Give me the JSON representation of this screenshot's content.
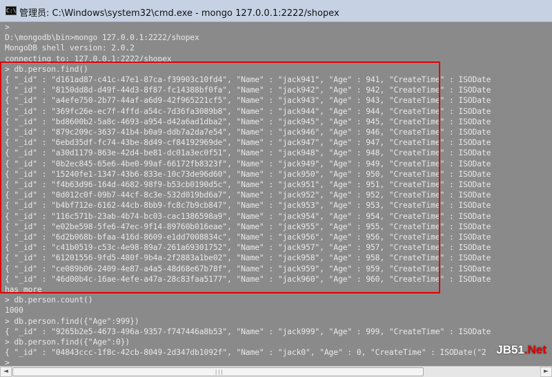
{
  "window": {
    "title": "管理员: C:\\Windows\\system32\\cmd.exe - mongo  127.0.0.1:2222/shopex",
    "icon": "cmd-icon"
  },
  "console": {
    "lines": [
      ">",
      "D:\\mongodb\\bin>mongo 127.0.0.1:2222/shopex",
      "MongoDB shell version: 2.0.2",
      "connecting to: 127.0.0.1:2222/shopex",
      "> db.person.find()",
      "{ \"_id\" : \"d161ad87-c41c-47e1-87ca-f39903c10fd4\", \"Name\" : \"jack941\", \"Age\" : 941, \"CreateTime\" : ISODate",
      "{ \"_id\" : \"8150dd8d-d49f-44d3-8f87-fc14388bf0fa\", \"Name\" : \"jack942\", \"Age\" : 942, \"CreateTime\" : ISODate",
      "{ \"_id\" : \"a4efe750-2b77-44af-a6d9-42f965221cf5\", \"Name\" : \"jack943\", \"Age\" : 943, \"CreateTime\" : ISODate",
      "{ \"_id\" : \"369fc26e-ec7f-4ffd-a54c-7d36fa3089b8\", \"Name\" : \"jack944\", \"Age\" : 944, \"CreateTime\" : ISODate",
      "{ \"_id\" : \"bd8600b2-5a8c-4693-a954-d42a6ad1dba2\", \"Name\" : \"jack945\", \"Age\" : 945, \"CreateTime\" : ISODate",
      "{ \"_id\" : \"879c209c-3637-41b4-b0a9-ddb7a2da7e54\", \"Name\" : \"jack946\", \"Age\" : 946, \"CreateTime\" : ISODate",
      "{ \"_id\" : \"6ebd35df-fc74-43be-8d49-cf84192969de\", \"Name\" : \"jack947\", \"Age\" : 947, \"CreateTime\" : ISODate",
      "{ \"_id\" : \"a30d1179-863e-42d4-be81-dc01a3ec0f51\", \"Name\" : \"jack948\", \"Age\" : 948, \"CreateTime\" : ISODate",
      "{ \"_id\" : \"0b2ec845-65e6-4be0-99af-66172fb8323f\", \"Name\" : \"jack949\", \"Age\" : 949, \"CreateTime\" : ISODate",
      "{ \"_id\" : \"15240fe1-1347-43b6-833e-10c73de96d60\", \"Name\" : \"jack950\", \"Age\" : 950, \"CreateTime\" : ISODate",
      "{ \"_id\" : \"f4b63d96-164d-4682-98f9-b53cb0190d5c\", \"Name\" : \"jack951\", \"Age\" : 951, \"CreateTime\" : ISODate",
      "{ \"_id\" : \"0d012c0f-09b7-44cf-8c3e-532d019bd6a7\", \"Name\" : \"jack952\", \"Age\" : 952, \"CreateTime\" : ISODate",
      "{ \"_id\" : \"b4bf712e-6162-44cb-8bb9-fc8c7b9cb847\", \"Name\" : \"jack953\", \"Age\" : 953, \"CreateTime\" : ISODate",
      "{ \"_id\" : \"116c571b-23ab-4b74-bc03-cac1386598a9\", \"Name\" : \"jack954\", \"Age\" : 954, \"CreateTime\" : ISODate",
      "{ \"_id\" : \"e02be598-5fe6-47ec-9f14-89760b016eae\", \"Name\" : \"jack955\", \"Age\" : 955, \"CreateTime\" : ISODate",
      "{ \"_id\" : \"6d2b068b-bfaa-416d-8609-e1dd7008834c\", \"Name\" : \"jack956\", \"Age\" : 956, \"CreateTime\" : ISODate",
      "{ \"_id\" : \"c41b0519-c53c-4e98-89a7-261a69301752\", \"Name\" : \"jack957\", \"Age\" : 957, \"CreateTime\" : ISODate",
      "{ \"_id\" : \"61201556-9fd5-480f-9b4a-2f2883a1be02\", \"Name\" : \"jack958\", \"Age\" : 958, \"CreateTime\" : ISODate",
      "{ \"_id\" : \"ce089b06-2409-4e87-a4a5-48d68e67b78f\", \"Name\" : \"jack959\", \"Age\" : 959, \"CreateTime\" : ISODate",
      "{ \"_id\" : \"46d00b4c-16ae-4efe-a47a-28c83faa5177\", \"Name\" : \"jack960\", \"Age\" : 960, \"CreateTime\" : ISODate",
      "has more",
      "> db.person.count()",
      "1000",
      "> db.person.find({\"Age\":999})",
      "{ \"_id\" : \"9265b2e5-4673-496a-9357-f747446a8b53\", \"Name\" : \"jack999\", \"Age\" : 999, \"CreateTime\" : ISODate",
      "> db.person.find({\"Age\":0})",
      "{ \"_id\" : \"04843ccc-1f8c-42cb-8049-2d347db1092f\", \"Name\" : \"jack0\", \"Age\" : 0, \"CreateTime\" : ISODate(\"2",
      ">"
    ]
  },
  "scrollbar": {
    "left_arrow": "◄",
    "right_arrow": "►",
    "grip": "|||"
  },
  "watermark": {
    "text": "JB51",
    "suffix": ".Net"
  },
  "colors": {
    "console_bg": "#8a8a8a",
    "console_fg": "#e8e8e8",
    "highlight": "#e00000",
    "titlebar": "#c6d2e4"
  }
}
